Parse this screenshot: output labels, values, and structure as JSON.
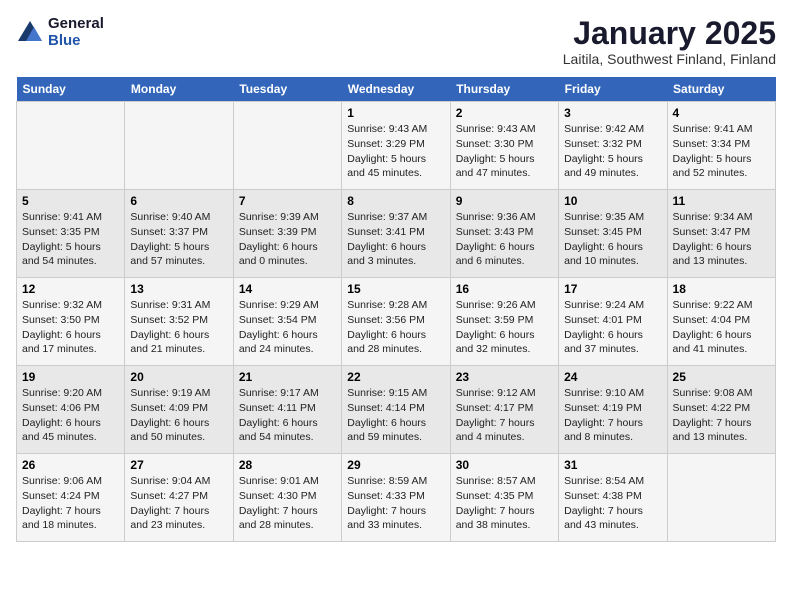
{
  "logo": {
    "general": "General",
    "blue": "Blue"
  },
  "header": {
    "month": "January 2025",
    "location": "Laitila, Southwest Finland, Finland"
  },
  "weekdays": [
    "Sunday",
    "Monday",
    "Tuesday",
    "Wednesday",
    "Thursday",
    "Friday",
    "Saturday"
  ],
  "weeks": [
    [
      {
        "day": "",
        "info": ""
      },
      {
        "day": "",
        "info": ""
      },
      {
        "day": "",
        "info": ""
      },
      {
        "day": "1",
        "info": "Sunrise: 9:43 AM\nSunset: 3:29 PM\nDaylight: 5 hours and 45 minutes."
      },
      {
        "day": "2",
        "info": "Sunrise: 9:43 AM\nSunset: 3:30 PM\nDaylight: 5 hours and 47 minutes."
      },
      {
        "day": "3",
        "info": "Sunrise: 9:42 AM\nSunset: 3:32 PM\nDaylight: 5 hours and 49 minutes."
      },
      {
        "day": "4",
        "info": "Sunrise: 9:41 AM\nSunset: 3:34 PM\nDaylight: 5 hours and 52 minutes."
      }
    ],
    [
      {
        "day": "5",
        "info": "Sunrise: 9:41 AM\nSunset: 3:35 PM\nDaylight: 5 hours and 54 minutes."
      },
      {
        "day": "6",
        "info": "Sunrise: 9:40 AM\nSunset: 3:37 PM\nDaylight: 5 hours and 57 minutes."
      },
      {
        "day": "7",
        "info": "Sunrise: 9:39 AM\nSunset: 3:39 PM\nDaylight: 6 hours and 0 minutes."
      },
      {
        "day": "8",
        "info": "Sunrise: 9:37 AM\nSunset: 3:41 PM\nDaylight: 6 hours and 3 minutes."
      },
      {
        "day": "9",
        "info": "Sunrise: 9:36 AM\nSunset: 3:43 PM\nDaylight: 6 hours and 6 minutes."
      },
      {
        "day": "10",
        "info": "Sunrise: 9:35 AM\nSunset: 3:45 PM\nDaylight: 6 hours and 10 minutes."
      },
      {
        "day": "11",
        "info": "Sunrise: 9:34 AM\nSunset: 3:47 PM\nDaylight: 6 hours and 13 minutes."
      }
    ],
    [
      {
        "day": "12",
        "info": "Sunrise: 9:32 AM\nSunset: 3:50 PM\nDaylight: 6 hours and 17 minutes."
      },
      {
        "day": "13",
        "info": "Sunrise: 9:31 AM\nSunset: 3:52 PM\nDaylight: 6 hours and 21 minutes."
      },
      {
        "day": "14",
        "info": "Sunrise: 9:29 AM\nSunset: 3:54 PM\nDaylight: 6 hours and 24 minutes."
      },
      {
        "day": "15",
        "info": "Sunrise: 9:28 AM\nSunset: 3:56 PM\nDaylight: 6 hours and 28 minutes."
      },
      {
        "day": "16",
        "info": "Sunrise: 9:26 AM\nSunset: 3:59 PM\nDaylight: 6 hours and 32 minutes."
      },
      {
        "day": "17",
        "info": "Sunrise: 9:24 AM\nSunset: 4:01 PM\nDaylight: 6 hours and 37 minutes."
      },
      {
        "day": "18",
        "info": "Sunrise: 9:22 AM\nSunset: 4:04 PM\nDaylight: 6 hours and 41 minutes."
      }
    ],
    [
      {
        "day": "19",
        "info": "Sunrise: 9:20 AM\nSunset: 4:06 PM\nDaylight: 6 hours and 45 minutes."
      },
      {
        "day": "20",
        "info": "Sunrise: 9:19 AM\nSunset: 4:09 PM\nDaylight: 6 hours and 50 minutes."
      },
      {
        "day": "21",
        "info": "Sunrise: 9:17 AM\nSunset: 4:11 PM\nDaylight: 6 hours and 54 minutes."
      },
      {
        "day": "22",
        "info": "Sunrise: 9:15 AM\nSunset: 4:14 PM\nDaylight: 6 hours and 59 minutes."
      },
      {
        "day": "23",
        "info": "Sunrise: 9:12 AM\nSunset: 4:17 PM\nDaylight: 7 hours and 4 minutes."
      },
      {
        "day": "24",
        "info": "Sunrise: 9:10 AM\nSunset: 4:19 PM\nDaylight: 7 hours and 8 minutes."
      },
      {
        "day": "25",
        "info": "Sunrise: 9:08 AM\nSunset: 4:22 PM\nDaylight: 7 hours and 13 minutes."
      }
    ],
    [
      {
        "day": "26",
        "info": "Sunrise: 9:06 AM\nSunset: 4:24 PM\nDaylight: 7 hours and 18 minutes."
      },
      {
        "day": "27",
        "info": "Sunrise: 9:04 AM\nSunset: 4:27 PM\nDaylight: 7 hours and 23 minutes."
      },
      {
        "day": "28",
        "info": "Sunrise: 9:01 AM\nSunset: 4:30 PM\nDaylight: 7 hours and 28 minutes."
      },
      {
        "day": "29",
        "info": "Sunrise: 8:59 AM\nSunset: 4:33 PM\nDaylight: 7 hours and 33 minutes."
      },
      {
        "day": "30",
        "info": "Sunrise: 8:57 AM\nSunset: 4:35 PM\nDaylight: 7 hours and 38 minutes."
      },
      {
        "day": "31",
        "info": "Sunrise: 8:54 AM\nSunset: 4:38 PM\nDaylight: 7 hours and 43 minutes."
      },
      {
        "day": "",
        "info": ""
      }
    ]
  ]
}
